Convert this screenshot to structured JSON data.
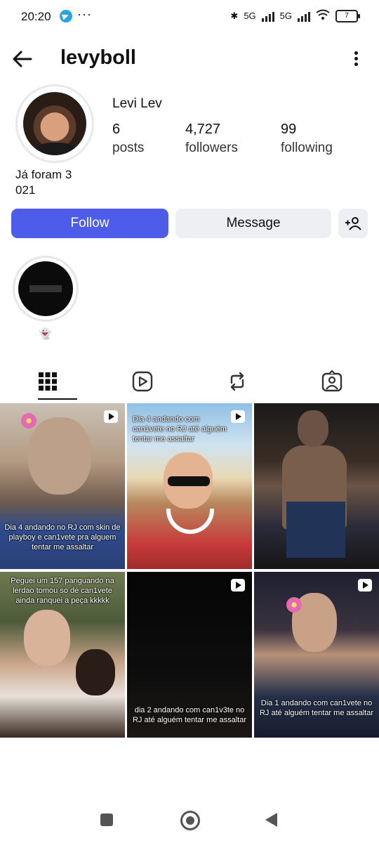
{
  "status_bar": {
    "time": "20:20",
    "more": "···",
    "net1": "5G",
    "net2": "5G",
    "battery": "7"
  },
  "header": {
    "username": "levyboll"
  },
  "profile": {
    "full_name": "Levi Lev",
    "stats": [
      {
        "value": "6",
        "label": "posts"
      },
      {
        "value": "4,727",
        "label": "followers"
      },
      {
        "value": "99",
        "label": "following"
      }
    ],
    "bio": "Já foram 3 021"
  },
  "actions": {
    "follow": "Follow",
    "message": "Message"
  },
  "highlights": [
    {
      "emoji": "👻"
    }
  ],
  "tabs": [
    "grid-icon",
    "reels-icon",
    "reposts-icon",
    "tagged-icon"
  ],
  "posts": [
    {
      "caption": "Dia 4 andando no RJ com skin de playboy e can1vete pra alguem tentar me assaltar",
      "reel": true
    },
    {
      "caption": "Dia 4 andando com can1vete no RJ até alguém tentar me assaltar",
      "reel": true
    },
    {
      "caption": "",
      "reel": false
    },
    {
      "caption": "Peguei um 157 panguando na lerdao tomou so de can1vete ainda ranquei a peça kkkkk",
      "reel": false
    },
    {
      "caption": "dia 2 andando com can1v3te no RJ até alguém tentar me assaltar",
      "reel": true
    },
    {
      "caption": "Dia 1 andando com can1vete no RJ até alguém tentar me assaltar",
      "reel": true
    }
  ]
}
